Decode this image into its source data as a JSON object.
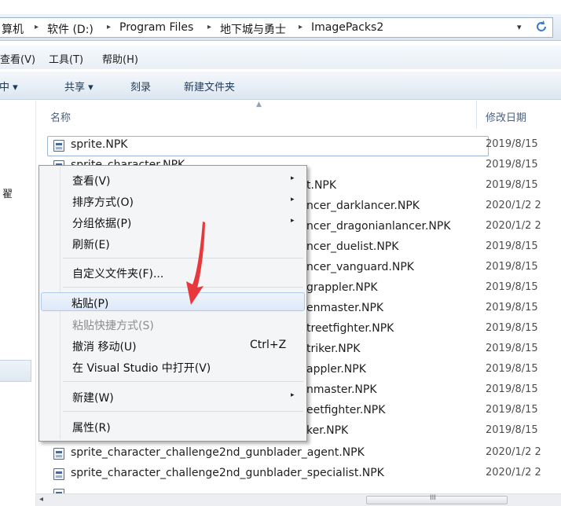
{
  "address_bar": {
    "crumbs": [
      "算机",
      "软件 (D:)",
      "Program Files",
      "地下城与勇士",
      "ImagePacks2"
    ],
    "separator": "▸",
    "dropdown_glyph": "▾",
    "refresh_icon": "refresh-icon"
  },
  "menu_bar": {
    "items": [
      "查看(V)",
      "工具(T)",
      "帮助(H)"
    ]
  },
  "toolbar": {
    "items": [
      "库中 ▾",
      "共享 ▾",
      "刻录",
      "新建文件夹"
    ]
  },
  "nav_pane": {
    "visible_char": "翟"
  },
  "columns": {
    "name": "名称",
    "date": "修改日期"
  },
  "files": [
    {
      "name": "sprite.NPK",
      "date": "2019/8/15"
    },
    {
      "name": "sprite_character.NPK",
      "date": "2019/8/15"
    },
    {
      "name": "t.NPK",
      "date": "2019/8/15"
    },
    {
      "name": "ncer_darklancer.NPK",
      "date": "2020/1/2 2"
    },
    {
      "name": "ncer_dragonianlancer.NPK",
      "date": "2020/1/2 2"
    },
    {
      "name": "ncer_duelist.NPK",
      "date": "2019/8/15"
    },
    {
      "name": "ncer_vanguard.NPK",
      "date": "2019/8/15"
    },
    {
      "name": "grappler.NPK",
      "date": "2019/8/15"
    },
    {
      "name": "enmaster.NPK",
      "date": "2019/8/15"
    },
    {
      "name": "treetfighter.NPK",
      "date": "2019/8/15"
    },
    {
      "name": "triker.NPK",
      "date": "2019/8/15"
    },
    {
      "name": "appler.NPK",
      "date": "2019/8/15"
    },
    {
      "name": "nmaster.NPK",
      "date": "2019/8/15"
    },
    {
      "name": "eetfighter.NPK",
      "date": "2019/8/15"
    },
    {
      "name": "ker.NPK",
      "date": "2019/8/15"
    },
    {
      "name": "sprite_character_challenge2nd_gunblader_agent.NPK",
      "date": "2020/1/2 2"
    },
    {
      "name": "sprite_character_challenge2nd_gunblader_specialist.NPK",
      "date": "2020/1/2 2"
    }
  ],
  "context_menu": {
    "items": [
      {
        "label": "查看(V)",
        "submenu": "▸"
      },
      {
        "label": "排序方式(O)",
        "submenu": "▸"
      },
      {
        "label": "分组依据(P)",
        "submenu": "▸"
      },
      {
        "label": "刷新(E)"
      },
      {
        "label": "自定义文件夹(F)..."
      },
      {
        "label": "粘贴(P)",
        "highlighted": true
      },
      {
        "label": "粘贴快捷方式(S)",
        "disabled": true
      },
      {
        "label": "撤消 移动(U)",
        "shortcut": "Ctrl+Z"
      },
      {
        "label": "在 Visual Studio 中打开(V)"
      },
      {
        "label": "新建(W)",
        "submenu": "▸"
      },
      {
        "label": "属性(R)"
      }
    ]
  },
  "scrollbar": {
    "left_arrow": "◂",
    "grip": "III"
  },
  "colors": {
    "menu_highlight": "#dde9f8",
    "annotation_arrow": "#e8383b",
    "toolbar_text": "#1e395b"
  }
}
